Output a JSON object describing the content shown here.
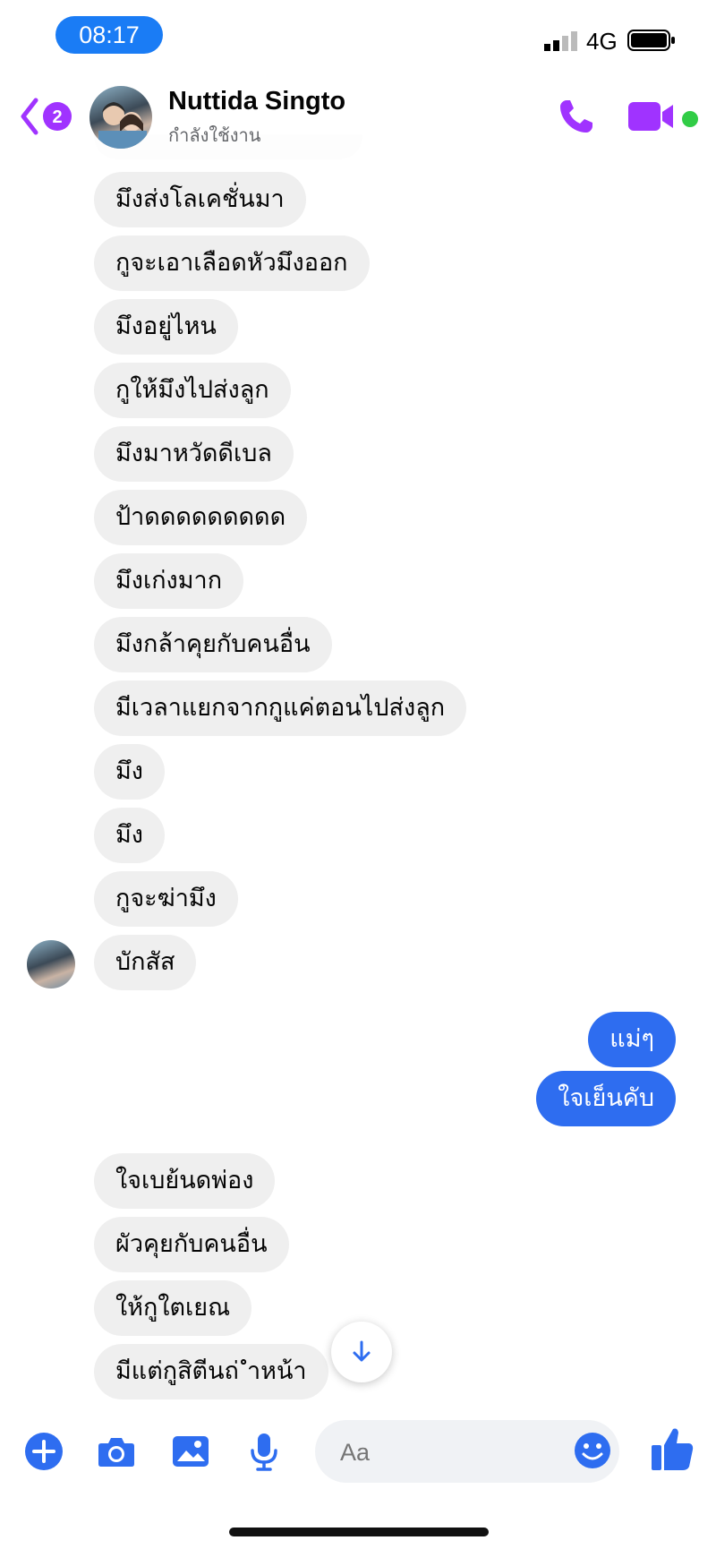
{
  "status_bar": {
    "time": "08:17",
    "network": "4G"
  },
  "header": {
    "back_badge": "2",
    "contact_name": "Nuttida Singto",
    "contact_status": "กำลังใช้งาน"
  },
  "messages": [
    {
      "from": "them",
      "text": "มึงส่งโลเคชั่นมา"
    },
    {
      "from": "them",
      "text": "กูจะเอาเลือดหัวมึงออก"
    },
    {
      "from": "them",
      "text": "มึงอยู่ไหน"
    },
    {
      "from": "them",
      "text": "กูให้มึงไปส่งลูก"
    },
    {
      "from": "them",
      "text": "มึงมาหวัดดีเบล"
    },
    {
      "from": "them",
      "text": "ป้าดดดดดดดดด"
    },
    {
      "from": "them",
      "text": "มึงเก่งมาก"
    },
    {
      "from": "them",
      "text": "มึงกล้าคุยกับคนอื่น"
    },
    {
      "from": "them",
      "text": "มีเวลาแยกจากกูแค่ตอนไปส่งลูก"
    },
    {
      "from": "them",
      "text": "มึง"
    },
    {
      "from": "them",
      "text": "มึง"
    },
    {
      "from": "them",
      "text": "กูจะฆ่ามึง"
    },
    {
      "from": "them",
      "text": "บักสัส"
    },
    {
      "from": "me",
      "text": "แม่ๆ"
    },
    {
      "from": "me",
      "text": "ใจเย็นคับ"
    },
    {
      "from": "them",
      "text": "ใจเบย้นดพ่อง"
    },
    {
      "from": "them",
      "text": "ผัวคุยกับคนอื่น"
    },
    {
      "from": "them",
      "text": "ให้กูใตเยณ"
    },
    {
      "from": "them",
      "text": "มีแต่กูสิตีนถ่ ำหน้า"
    }
  ],
  "composer": {
    "placeholder": "Aa",
    "icons": [
      "plus-icon",
      "camera-icon",
      "image-icon",
      "microphone-icon",
      "emoji-icon",
      "thumbs-up-icon"
    ]
  },
  "colors": {
    "accent": "#2e6df0",
    "header_icons": "#a033ff",
    "incoming_bubble": "#efefef",
    "online": "#31cc46"
  }
}
